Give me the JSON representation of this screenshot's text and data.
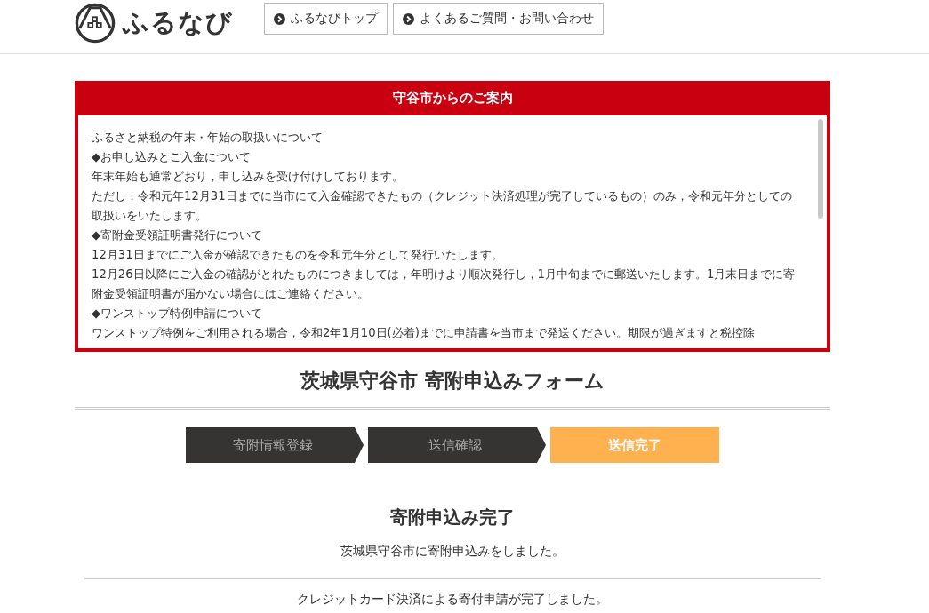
{
  "header": {
    "logo_text": "ふるなび",
    "nav": [
      {
        "label": "ふるなびトップ"
      },
      {
        "label": "よくあるご質問・お問い合わせ"
      }
    ]
  },
  "notice": {
    "title": "守谷市からのご案内",
    "paragraphs": [
      "ふるさと納税の年末・年始の取扱いについて",
      "◆お申し込みとご入金について",
      "年末年始も通常どおり，申し込みを受け付けしております。",
      "ただし，令和元年12月31日までに当市にて入金確認できたもの（クレジット決済処理が完了しているもの）のみ，令和元年分としての取扱いをいたします。",
      "◆寄附金受領証明書発行について",
      "12月31日までにご入金が確認できたものを令和元年分として発行いたします。",
      "12月26日以降にご入金の確認がとれたものにつきましては，年明けより順次発行し，1月中旬までに郵送いたします。1月末日までに寄附金受領証明書が届かない場合にはご連絡ください。",
      "◆ワンストップ特例申請について",
      "ワンストップ特例をご利用される場合，令和2年1月10日(必着)までに申請書を当市まで発送ください。期限が過ぎますと税控除"
    ]
  },
  "form_title": "茨城県守谷市 寄附申込みフォーム",
  "steps": [
    {
      "label": "寄附情報登録",
      "selected": false
    },
    {
      "label": "送信確認",
      "selected": false
    },
    {
      "label": "送信完了",
      "selected": true
    }
  ],
  "complete": {
    "heading": "寄附申込み完了",
    "message": "茨城県守谷市に寄附申込みをしました。",
    "note": "クレジットカード決済による寄付申請が完了しました。"
  }
}
